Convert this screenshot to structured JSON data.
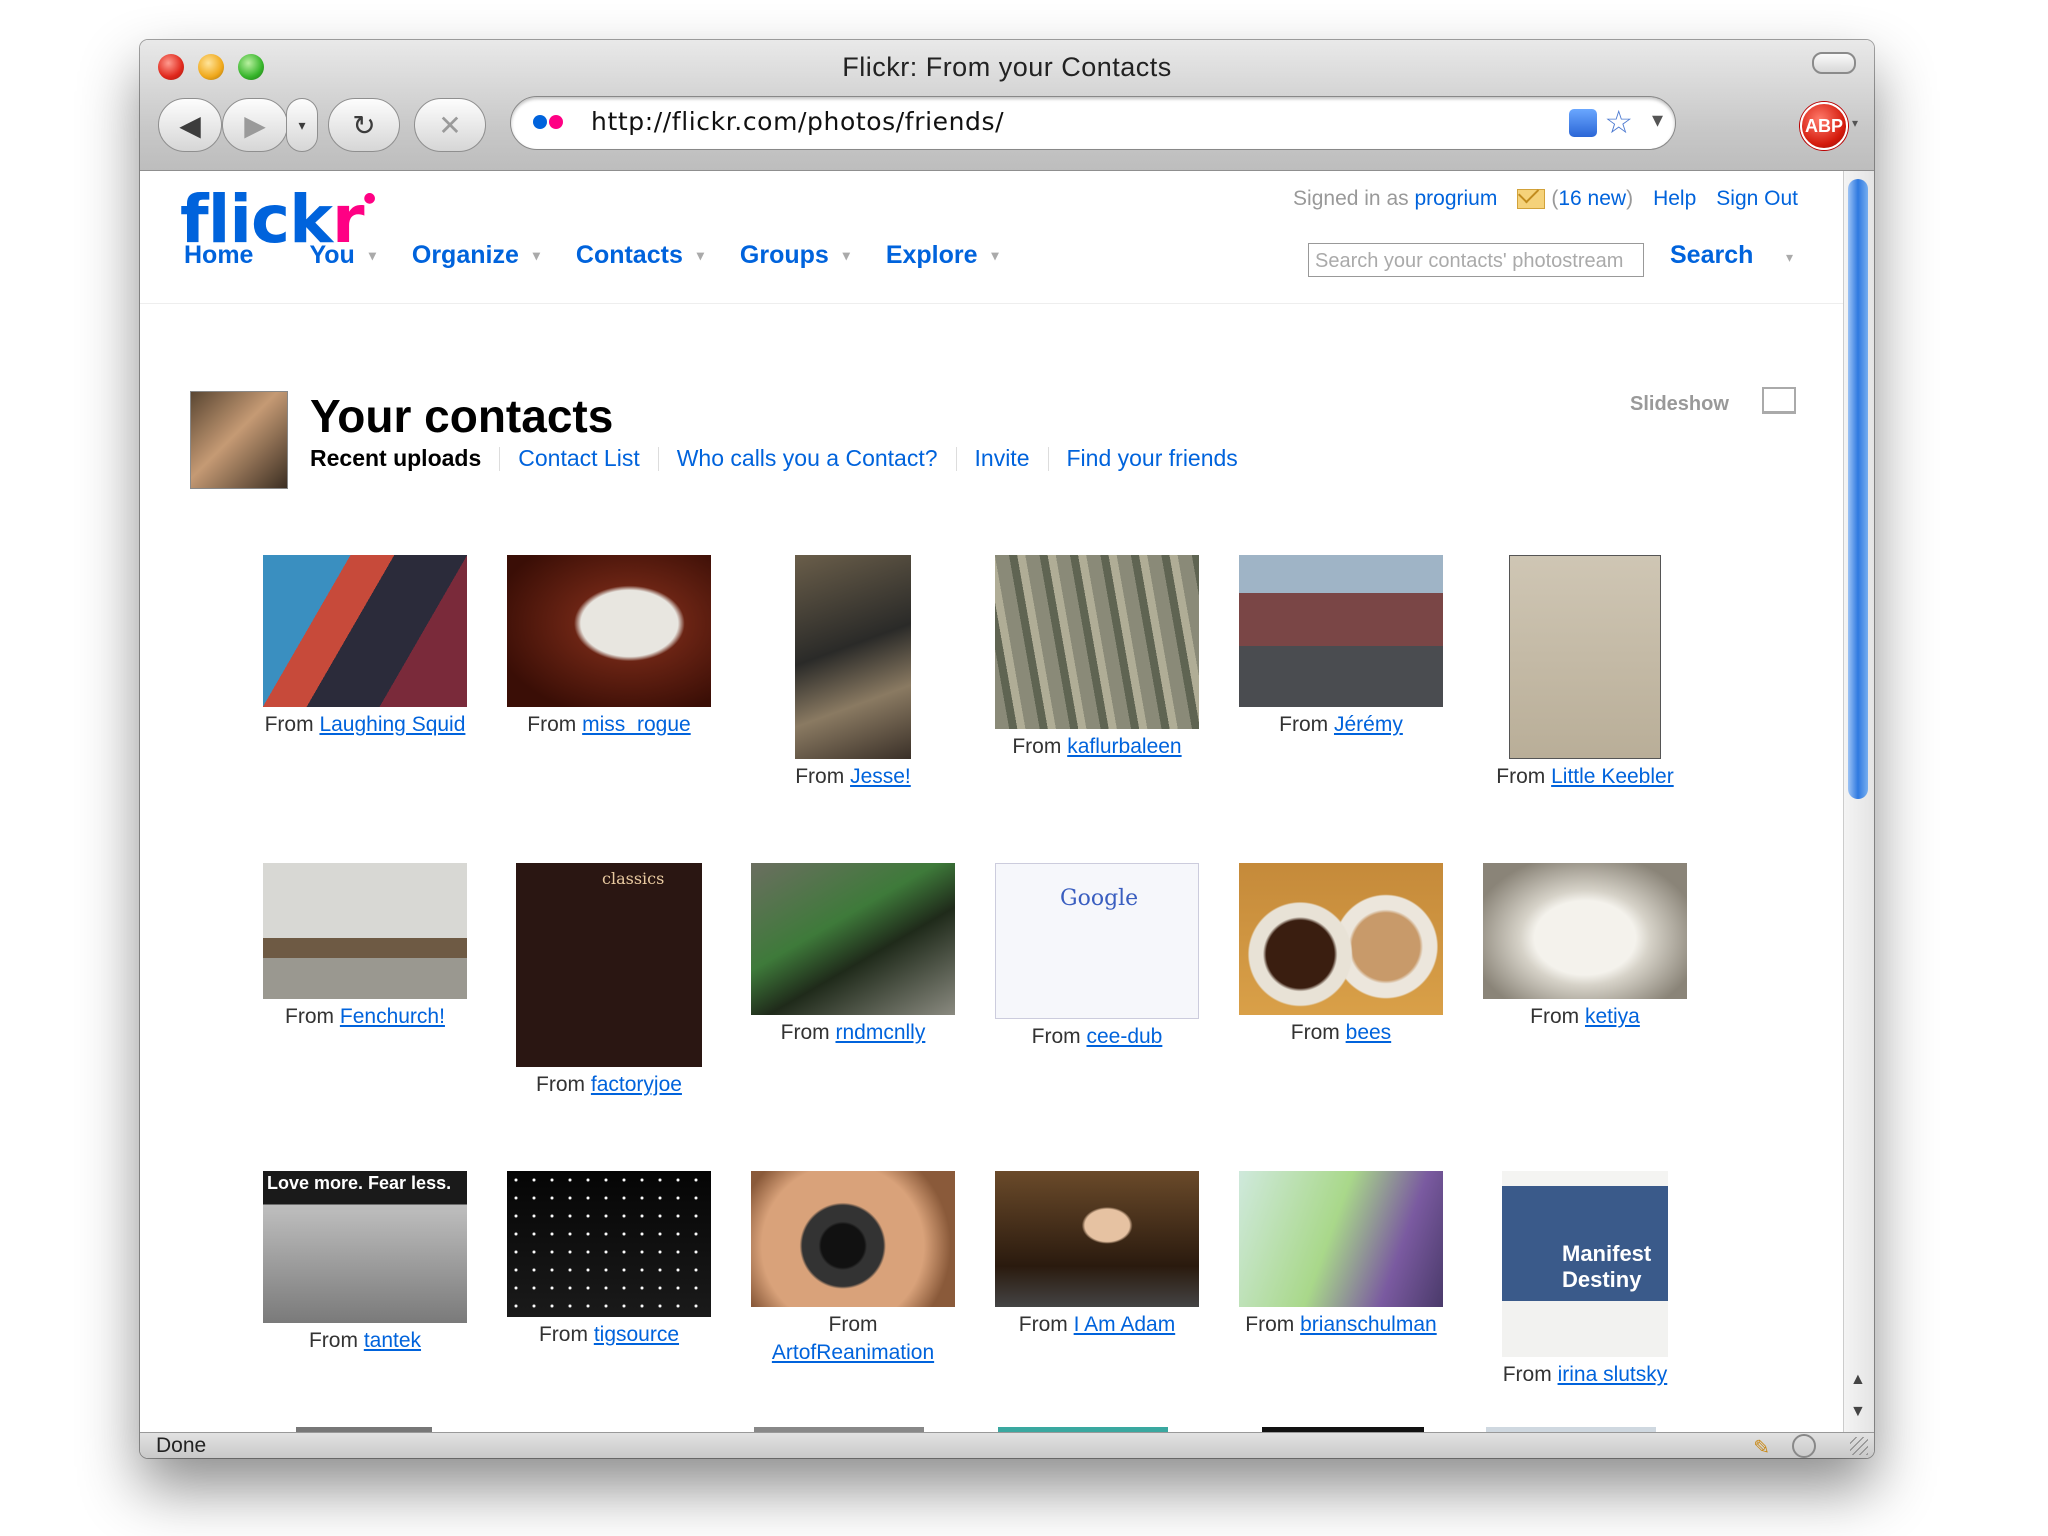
{
  "window": {
    "title": "Flickr: From your Contacts"
  },
  "toolbar": {
    "url": "http://flickr.com/photos/friends/",
    "back_icon": "◀",
    "forward_icon": "▶",
    "history_icon": "▾",
    "reload_icon": "↻",
    "stop_icon": "✕",
    "star_icon": "☆",
    "drop_icon": "▾",
    "abp_label": "ABP"
  },
  "header": {
    "logo_main": "flick",
    "logo_accent": "r",
    "signed_in_prefix": "Signed in as",
    "username": "progrium",
    "mail_open": "(",
    "mail_count": "16 new",
    "mail_close": ")",
    "help": "Help",
    "sign_out": "Sign Out"
  },
  "nav": {
    "home": "Home",
    "you": "You",
    "organize": "Organize",
    "contacts": "Contacts",
    "groups": "Groups",
    "explore": "Explore",
    "caret": "▾"
  },
  "search": {
    "placeholder": "Search your contacts' photostream",
    "button": "Search"
  },
  "page": {
    "title": "Your contacts",
    "tabs": {
      "current": "Recent uploads",
      "contact_list": "Contact List",
      "who_calls": "Who calls you a Contact?",
      "invite": "Invite",
      "find_friends": "Find your friends"
    },
    "slideshow": "Slideshow"
  },
  "photos": [
    {
      "from": "From",
      "name": "Laughing Squid"
    },
    {
      "from": "From",
      "name": "miss_rogue"
    },
    {
      "from": "From",
      "name": "Jesse!"
    },
    {
      "from": "From",
      "name": "kaflurbaleen"
    },
    {
      "from": "From",
      "name": "Jérémy"
    },
    {
      "from": "From",
      "name": "Little Keebler"
    },
    {
      "from": "From",
      "name": "Fenchurch!"
    },
    {
      "from": "From",
      "name": "factoryjoe"
    },
    {
      "from": "From",
      "name": "rndmcnlly"
    },
    {
      "from": "From",
      "name": "cee-dub"
    },
    {
      "from": "From",
      "name": "bees"
    },
    {
      "from": "From",
      "name": "ketiya"
    },
    {
      "from": "From",
      "name": "tantek"
    },
    {
      "from": "From",
      "name": "tigsource"
    },
    {
      "from": "From",
      "name": "ArtofReanimation"
    },
    {
      "from": "From",
      "name": "I Am Adam"
    },
    {
      "from": "From",
      "name": "brianschulman"
    },
    {
      "from": "From",
      "name": "irina slutsky"
    }
  ],
  "thumb_text": {
    "tantek": "Love more. Fear less.",
    "factoryjoe": "classics",
    "ceedub": "Google",
    "irina": "Manifest Destiny"
  },
  "scroll": {
    "up": "▲",
    "down": "▼"
  },
  "status": {
    "text": "Done",
    "pen_icon": "✎"
  }
}
